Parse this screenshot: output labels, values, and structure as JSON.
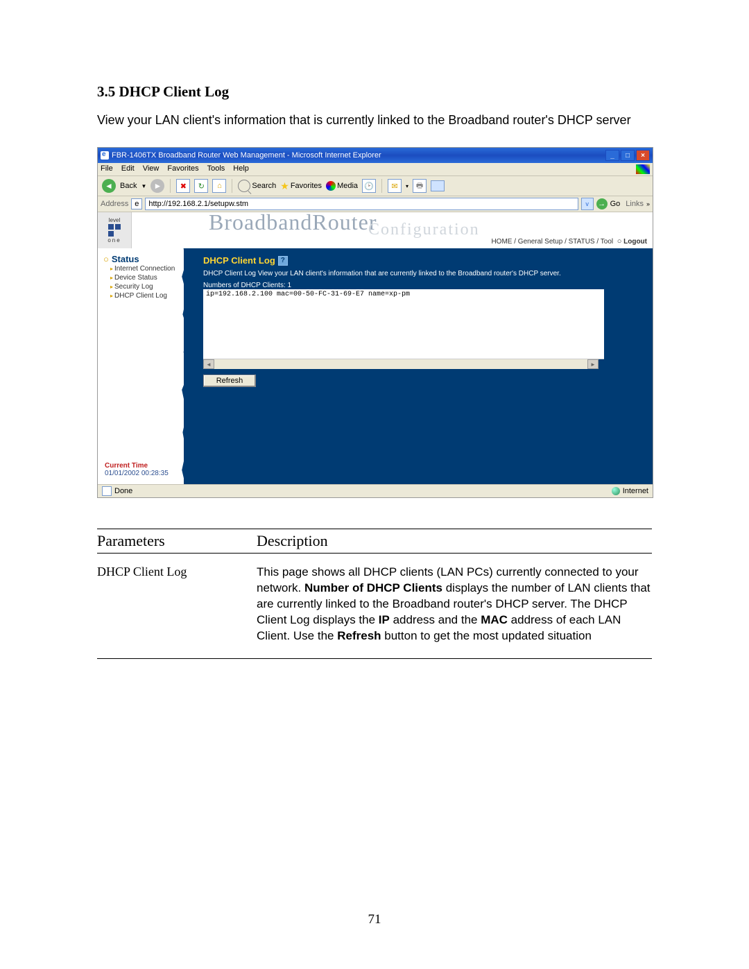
{
  "doc": {
    "section_title": "3.5 DHCP Client Log",
    "intro": "View your LAN client's information that is currently linked to the Broadband router's DHCP server",
    "page_number": "71"
  },
  "browser": {
    "window_title": "FBR-1406TX Broadband Router Web Management - Microsoft Internet Explorer",
    "menu": {
      "file": "File",
      "edit": "Edit",
      "view": "View",
      "favorites": "Favorites",
      "tools": "Tools",
      "help": "Help"
    },
    "toolbar": {
      "back": "Back",
      "search": "Search",
      "favorites": "Favorites",
      "media": "Media"
    },
    "address_label": "Address",
    "url": "http://192.168.2.1/setupw.stm",
    "go": "Go",
    "links": "Links",
    "status_done": "Done",
    "zone": "Internet"
  },
  "router": {
    "logo_top": "level",
    "logo_bottom": "one",
    "banner_t1": "BroadbandRouter",
    "banner_t2": "Configuration",
    "crumb": {
      "home": "HOME",
      "gensetup": "General Setup",
      "status": "STATUS",
      "tool": "Tool",
      "logout": "Logout"
    },
    "sidebar": {
      "header": "Status",
      "items": [
        "Internet Connection",
        "Device Status",
        "Security Log",
        "DHCP Client Log"
      ],
      "current_time_label": "Current Time",
      "current_time_value": "01/01/2002 00:28:35"
    },
    "content": {
      "title": "DHCP Client Log",
      "desc": "DHCP Client Log View your LAN client's information that are currently linked to the Broadband router's DHCP server.",
      "clients_label": "Numbers of DHCP Clients:",
      "clients_count": "1",
      "log_line": "ip=192.168.2.100   mac=00-50-FC-31-69-E7   name=xp-pm",
      "refresh": "Refresh"
    }
  },
  "params": {
    "col1": "Parameters",
    "col2": "Description",
    "row_name": "DHCP Client Log",
    "row_desc_pre": "This page shows all DHCP clients (LAN PCs) currently connected to your network. ",
    "b1": "Number of DHCP Clients",
    "row_desc_mid": " displays the number of LAN clients that are currently linked to the Broadband router's DHCP server. The DHCP Client Log displays the ",
    "b2": "IP",
    "row_desc_mid2": " address and the ",
    "b3": "MAC",
    "row_desc_mid3": " address of each LAN Client. Use the ",
    "b4": "Refresh",
    "row_desc_end": " button to get the most updated situation"
  }
}
